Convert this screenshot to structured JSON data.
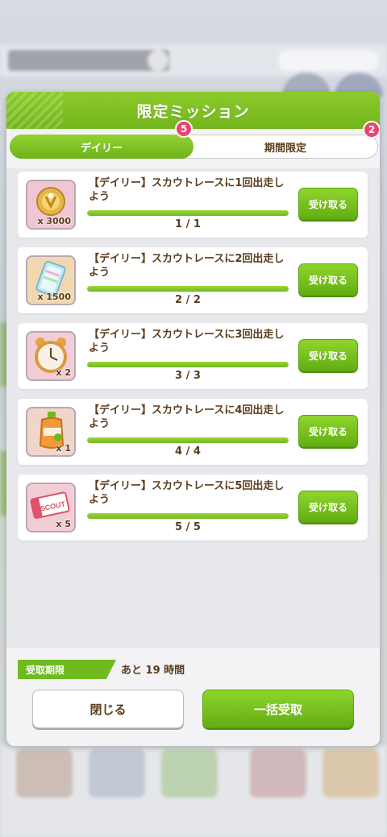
{
  "dialog": {
    "title": "限定ミッション",
    "tabs": [
      {
        "label": "デイリー",
        "badge": "5",
        "active": true
      },
      {
        "label": "期間限定",
        "badge": "2",
        "active": false
      }
    ]
  },
  "missions": [
    {
      "title": "【デイリー】スカウトレースに1回出走しよう",
      "reward_icon": "coin-icon",
      "reward_qty": "x 3000",
      "progress_text": "1 / 1",
      "progress": 1.0,
      "button": "受け取る"
    },
    {
      "title": "【デイリー】スカウトレースに2回出走しよう",
      "reward_icon": "ticket-icon",
      "reward_qty": "x 1500",
      "progress_text": "2 / 2",
      "progress": 1.0,
      "button": "受け取る"
    },
    {
      "title": "【デイリー】スカウトレースに3回出走しよう",
      "reward_icon": "alarm-clock-icon",
      "reward_qty": "x 2",
      "progress_text": "3 / 3",
      "progress": 1.0,
      "button": "受け取る"
    },
    {
      "title": "【デイリー】スカウトレースに4回出走しよう",
      "reward_icon": "drink-icon",
      "reward_qty": "x 1",
      "progress_text": "4 / 4",
      "progress": 1.0,
      "button": "受け取る"
    },
    {
      "title": "【デイリー】スカウトレースに5回出走しよう",
      "reward_icon": "scout-ticket-icon",
      "reward_qty": "x 5",
      "progress_text": "5 / 5",
      "progress": 1.0,
      "button": "受け取る"
    }
  ],
  "footer": {
    "deadline_label": "受取期限",
    "deadline_value": "あと 19 時間",
    "close_button": "閉じる",
    "claim_all_button": "一括受取"
  },
  "scout_ticket_text": "SCOUT",
  "colors": {
    "accent_green": "#73b51d",
    "badge_pink": "#e8456f",
    "text_brown": "#5a3d1e"
  }
}
